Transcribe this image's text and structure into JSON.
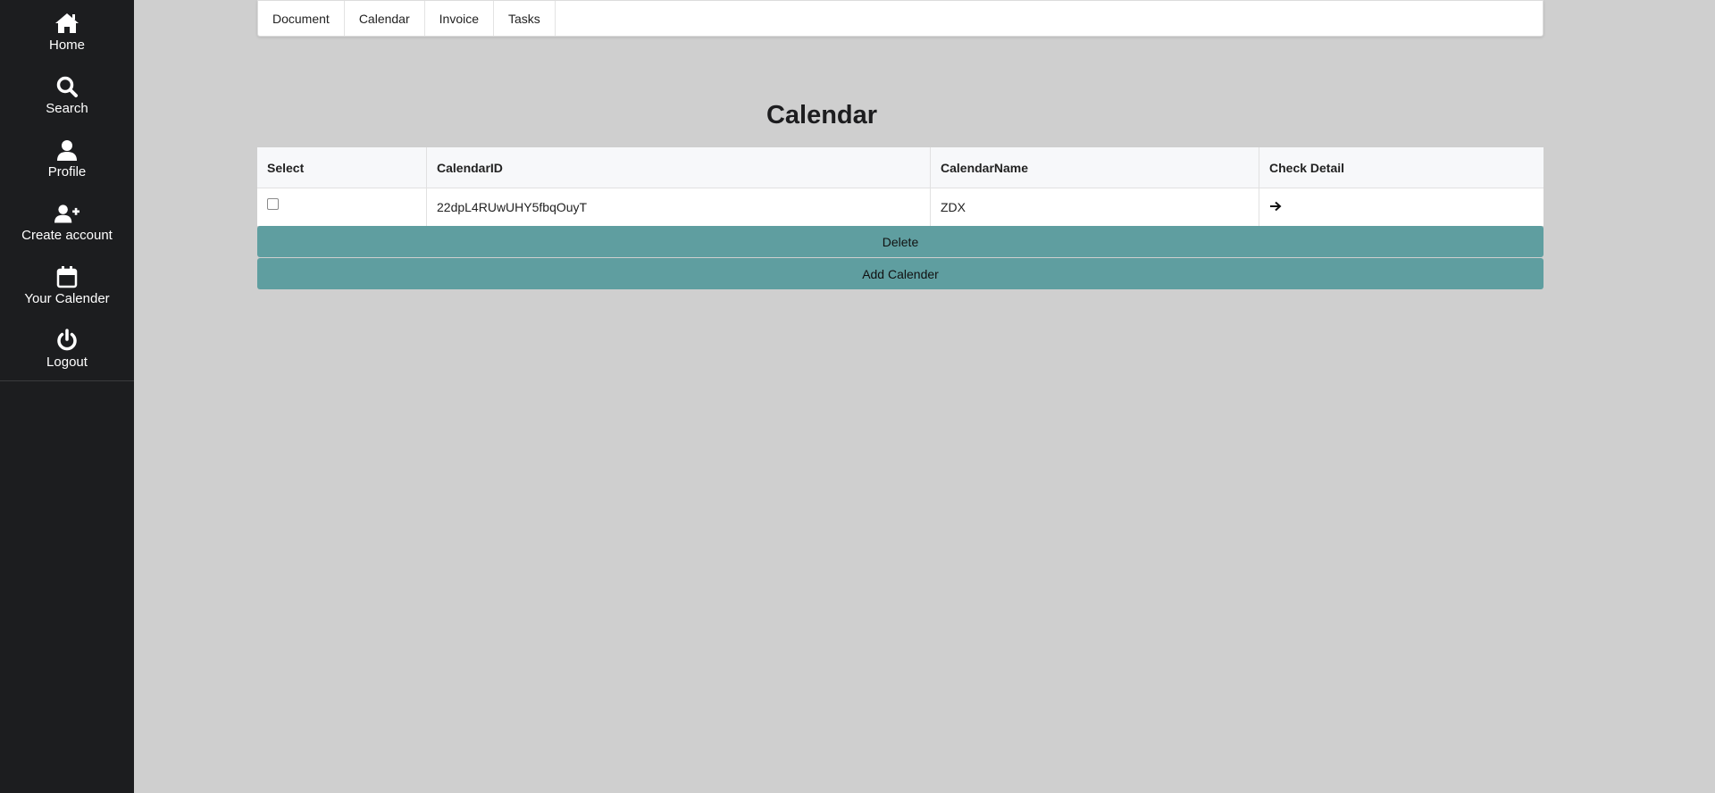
{
  "sidebar": {
    "items": [
      {
        "label": "Home",
        "icon": "home-icon"
      },
      {
        "label": "Search",
        "icon": "search-icon"
      },
      {
        "label": "Profile",
        "icon": "user-icon"
      },
      {
        "label": "Create account",
        "icon": "user-plus-icon"
      },
      {
        "label": "Your Calender",
        "icon": "calendar-icon"
      },
      {
        "label": "Logout",
        "icon": "power-icon"
      }
    ]
  },
  "topnav": {
    "tabs": [
      "Document",
      "Calendar",
      "Invoice",
      "Tasks"
    ]
  },
  "page": {
    "title": "Calendar"
  },
  "table": {
    "headers": [
      "Select",
      "CalendarID",
      "CalendarName",
      "Check Detail"
    ],
    "rows": [
      {
        "calendar_id": "22dpL4RUwUHY5fbqOuyT",
        "calendar_name": "ZDX",
        "detail_icon": "arrow-right-icon"
      }
    ]
  },
  "actions": {
    "delete_label": "Delete",
    "add_label": "Add Calender"
  },
  "colors": {
    "sidebar_bg": "#1c1d1f",
    "page_bg": "#cfcfcf",
    "button_bg": "#5f9ea0"
  }
}
